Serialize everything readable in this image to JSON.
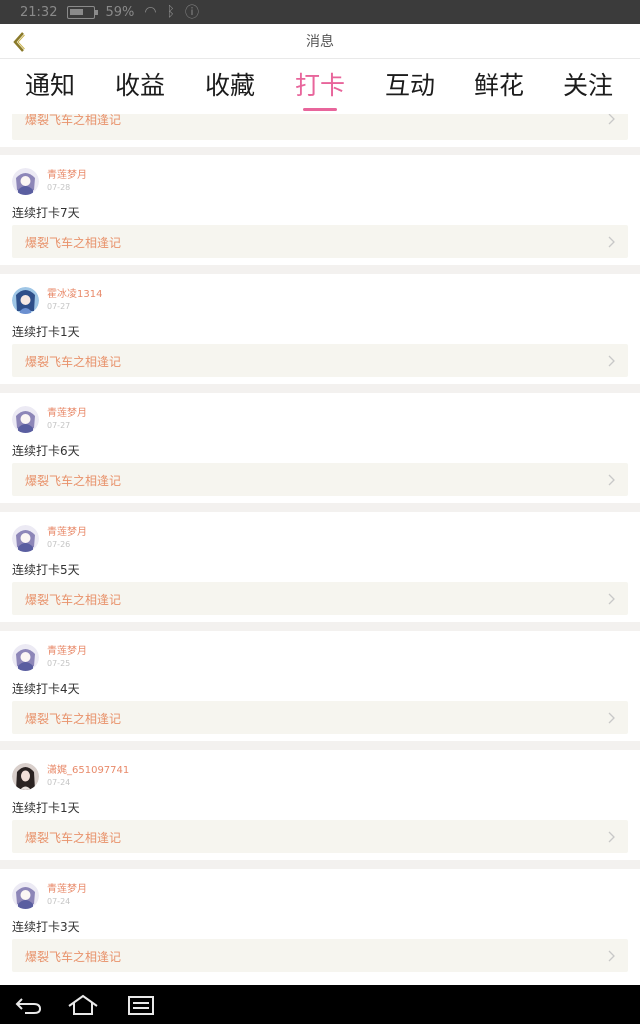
{
  "status_bar": {
    "time": "21:32",
    "battery": "59%"
  },
  "header": {
    "title": "消息"
  },
  "tabs": [
    {
      "label": "通知"
    },
    {
      "label": "收益"
    },
    {
      "label": "收藏"
    },
    {
      "label": "打卡"
    },
    {
      "label": "互动"
    },
    {
      "label": "鲜花"
    },
    {
      "label": "关注"
    }
  ],
  "active_tab": "打卡",
  "feed": {
    "partial_top_book": "爆裂飞车之相逢记",
    "items": [
      {
        "username": "青莲梦月",
        "date": "07-28",
        "text": "连续打卡7天",
        "book": "爆裂飞车之相逢记"
      },
      {
        "username": "霍冰凌1314",
        "date": "07-27",
        "text": "连续打卡1天",
        "book": "爆裂飞车之相逢记"
      },
      {
        "username": "青莲梦月",
        "date": "07-27",
        "text": "连续打卡6天",
        "book": "爆裂飞车之相逢记"
      },
      {
        "username": "青莲梦月",
        "date": "07-26",
        "text": "连续打卡5天",
        "book": "爆裂飞车之相逢记"
      },
      {
        "username": "青莲梦月",
        "date": "07-25",
        "text": "连续打卡4天",
        "book": "爆裂飞车之相逢记"
      },
      {
        "username": "潇娓_651097741",
        "date": "07-24",
        "text": "连续打卡1天",
        "book": "爆裂飞车之相逢记"
      },
      {
        "username": "青莲梦月",
        "date": "07-24",
        "text": "连续打卡3天",
        "book": "爆裂飞车之相逢记"
      }
    ]
  },
  "colors": {
    "accent": "#e8659b",
    "book_title": "#e8926b",
    "username": "#e88a6a"
  }
}
